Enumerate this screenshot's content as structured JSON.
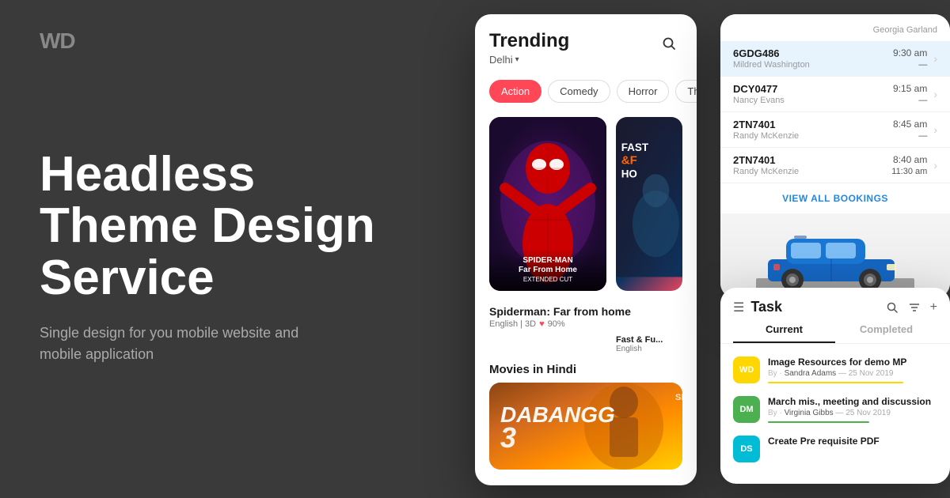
{
  "logo": {
    "text": "WD"
  },
  "hero": {
    "heading": "Headless\nTheme Design\nService",
    "subheading": "Single design for you mobile website and mobile application"
  },
  "movie_app": {
    "title": "Trending",
    "location": "Delhi",
    "location_arrow": "▾",
    "search_icon": "🔍",
    "genres": [
      {
        "label": "Action",
        "active": true
      },
      {
        "label": "Comedy",
        "active": false
      },
      {
        "label": "Horror",
        "active": false
      },
      {
        "label": "Thriller",
        "active": false
      }
    ],
    "featured_movie": {
      "title": "Spiderman: Far from home",
      "subtitle": "SPIDER-MAN\nFar From Home\nEXTENDED CUT",
      "lang": "English | 3D",
      "rating": "90%",
      "heart": "♥"
    },
    "secondary_movie": {
      "title": "Fast & Fu...",
      "lang": "English",
      "header": "FAST\n&FU\nHO"
    },
    "section_title": "Movies in Hindi",
    "bottom_movie": {
      "title": "DABANGG",
      "number": "3",
      "badge": "SKF"
    }
  },
  "booking_app": {
    "top_name": "Georgia Garland",
    "rows": [
      {
        "id": "6GDG486",
        "person": "Mildred Washington",
        "time_start": "9:30 am",
        "time_end": "—",
        "highlighted": true
      },
      {
        "id": "DCY0477",
        "person": "Nancy Evans",
        "time_start": "9:15 am",
        "time_end": "—",
        "highlighted": false
      },
      {
        "id": "2TN7401",
        "person": "Randy McKenzie",
        "time_start": "8:45 am",
        "time_end": "—",
        "highlighted": false
      },
      {
        "id": "2TN7401",
        "person": "Randy McKenzie",
        "time_start": "8:40 am",
        "time_end": "11:30 am",
        "highlighted": false
      }
    ],
    "view_all": "VIEW ALL BOOKINGS"
  },
  "task_app": {
    "menu_icon": "☰",
    "title": "Task",
    "search_icon": "⚲",
    "filter_icon": "⇅",
    "add_icon": "+",
    "tabs": [
      {
        "label": "Current",
        "active": true
      },
      {
        "label": "Completed",
        "active": false
      }
    ],
    "items": [
      {
        "avatar_initials": "WD",
        "avatar_class": "avatar-wd",
        "title": "Image Resources for demo MP",
        "by_label": "By ·",
        "author": "Sandra Adams",
        "date": "25 Nov 2019",
        "bar_class": "bar-yellow"
      },
      {
        "avatar_initials": "DM",
        "avatar_class": "avatar-dm",
        "title": "March mis., meeting and discussion",
        "by_label": "By ·",
        "author": "Virginia Gibbs",
        "date": "25 Nov 2019",
        "bar_class": "bar-green"
      },
      {
        "avatar_initials": "DS",
        "avatar_class": "avatar-ds",
        "title": "Create Pre requisite PDF",
        "by_label": "By ·",
        "author": "",
        "date": "",
        "bar_class": ""
      }
    ]
  }
}
